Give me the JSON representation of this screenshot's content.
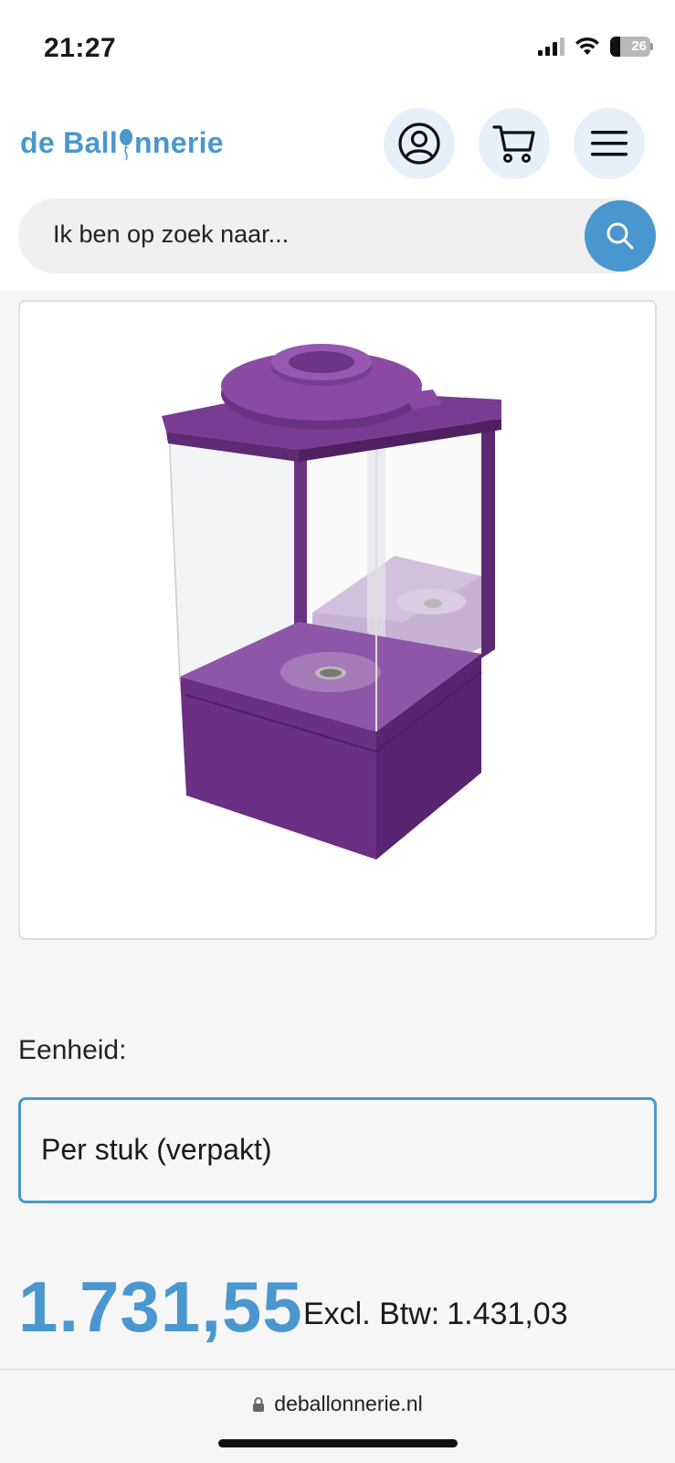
{
  "status_bar": {
    "time": "21:27",
    "battery": "26"
  },
  "header": {
    "logo_text_start": "de Ball",
    "logo_text_end": "nnerie",
    "icons": {
      "account": "user-circle-icon",
      "cart": "cart-icon",
      "menu": "hamburger-menu-icon",
      "search": "search-icon"
    }
  },
  "search": {
    "placeholder": "Ik ben op zoek naar..."
  },
  "product": {
    "image_subject": "purple balloon inflator box"
  },
  "unit": {
    "label": "Eenheid:",
    "selected": "Per stuk (verpakt)"
  },
  "price": {
    "amount": "1.731,55",
    "excl_label": "Excl. Btw:",
    "excl_amount": "1.431,03"
  },
  "browser": {
    "url": "deballonnerie.nl"
  },
  "colors": {
    "brand_blue": "#4a97cf",
    "product_purple": "#7b3f93"
  }
}
